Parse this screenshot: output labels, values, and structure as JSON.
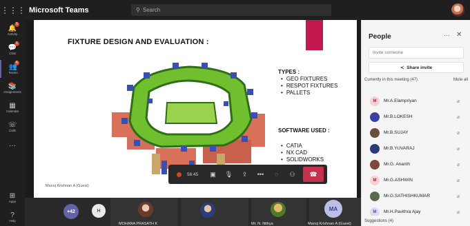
{
  "titlebar": {
    "app_title": "Microsoft Teams",
    "search_placeholder": "Search"
  },
  "rail": [
    {
      "icon": "activity-icon",
      "label": "Activity",
      "badge": "5"
    },
    {
      "icon": "chat-icon",
      "label": "Chat",
      "badge": "1"
    },
    {
      "icon": "teams-icon",
      "label": "Teams",
      "badge": "6"
    },
    {
      "icon": "assignments-icon",
      "label": "Assignments",
      "badge": ""
    },
    {
      "icon": "calendar-icon",
      "label": "Calendar",
      "badge": ""
    },
    {
      "icon": "calls-icon",
      "label": "Calls",
      "badge": ""
    },
    {
      "icon": "more-icon",
      "label": "",
      "badge": ""
    }
  ],
  "rail_bottom": [
    {
      "label": "Apps"
    },
    {
      "label": "Help"
    }
  ],
  "slide": {
    "title": "FIXTURE DESIGN AND EVALUATION :",
    "types_heading": "TYPES :",
    "types": [
      "GEO FIXTURES",
      "RESPOT FIXTURES",
      "PALLETS"
    ],
    "software_heading": "SOFTWARE USED :",
    "software": [
      "CATIA",
      "NX CAD",
      "SOLIDWORKS"
    ],
    "presenter_tag": "Manoj Krishnan A (Guest)"
  },
  "controls": {
    "timer": "56:45"
  },
  "gallery": {
    "overflow_count": "+42",
    "initial_tile": "H",
    "tiles": [
      {
        "name": "MOHANA PRASATH K"
      },
      {
        "name": ""
      },
      {
        "name": "Mr. N. Nithya"
      },
      {
        "name": "Manoj Krishnan A (Guest)",
        "initials": "MA"
      }
    ]
  },
  "panel": {
    "title": "People",
    "invite_placeholder": "Invite someone",
    "share_invite": "Share invite",
    "section": "Currently in this meeting (47)",
    "mute_all": "Mute all",
    "suggestions": "Suggestions (4)",
    "people": [
      {
        "name": "Mr.A.Elampriyan",
        "initial": "M",
        "color": "#f4d2d6",
        "fg": "#a4262c"
      },
      {
        "name": "Mr.B.LOKESH",
        "initial": "",
        "color": "#3b3fa8",
        "fg": "#fff"
      },
      {
        "name": "Mr.B.SUJAY",
        "initial": "",
        "color": "#6b4e3a",
        "fg": "#fff"
      },
      {
        "name": "Mr.B.YUVARAJ",
        "initial": "",
        "color": "#2d3a7a",
        "fg": "#fff"
      },
      {
        "name": "Mr.G. Ananth",
        "initial": "",
        "color": "#7a4a3a",
        "fg": "#fff"
      },
      {
        "name": "Mr.G.ASHWIN",
        "initial": "M",
        "color": "#f4d2d6",
        "fg": "#a4262c"
      },
      {
        "name": "Mr.G.SATHISHKUMAR",
        "initial": "",
        "color": "#5a6b4a",
        "fg": "#fff"
      },
      {
        "name": "Mr.H.Pavithra Ajay",
        "initial": "M",
        "color": "#dcdcf0",
        "fg": "#4b4da0"
      }
    ]
  }
}
